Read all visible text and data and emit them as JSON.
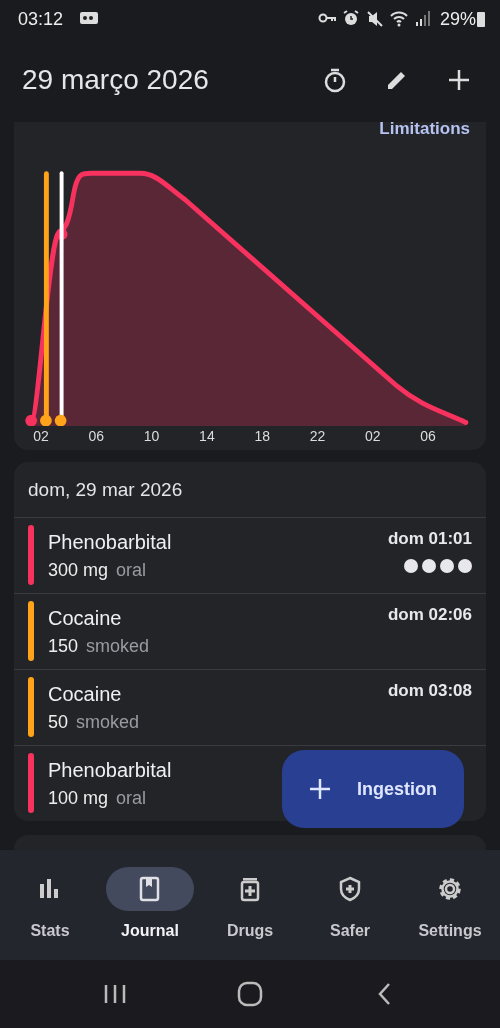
{
  "status_bar": {
    "time": "03:12",
    "battery": "29%"
  },
  "app_bar": {
    "title": "29 março 2026"
  },
  "timeline": {
    "limitations_link": "Limitations",
    "x_labels": [
      "02",
      "06",
      "10",
      "14",
      "18",
      "22",
      "02",
      "06"
    ]
  },
  "journal": {
    "date": "dom, 29 mar 2026",
    "ingestions": [
      {
        "substance": "Phenobarbital",
        "dose": "300 mg",
        "route": "oral",
        "time": "dom 01:01",
        "color": "#f8325f",
        "stars": 4
      },
      {
        "substance": "Cocaine",
        "dose": "150",
        "route": "smoked",
        "time": "dom 02:06",
        "color": "#ffa41a"
      },
      {
        "substance": "Cocaine",
        "dose": "50",
        "route": "smoked",
        "time": "dom 03:08",
        "color": "#ffa41a"
      },
      {
        "substance": "Phenobarbital",
        "dose": "100 mg",
        "route": "oral",
        "color": "#f8325f"
      }
    ]
  },
  "fab": {
    "label": "Ingestion"
  },
  "bottom_nav": [
    {
      "label": "Stats",
      "selected": false
    },
    {
      "label": "Journal",
      "selected": true
    },
    {
      "label": "Drugs",
      "selected": false
    },
    {
      "label": "Safer",
      "selected": false
    },
    {
      "label": "Settings",
      "selected": false
    }
  ]
}
